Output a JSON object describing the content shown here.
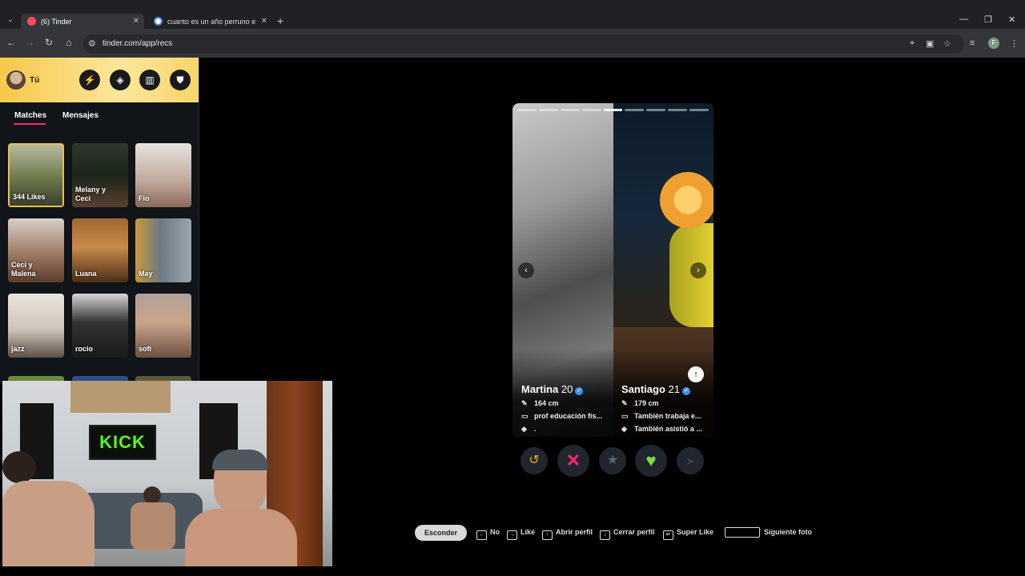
{
  "browser": {
    "tabs": [
      {
        "title": "(6) Tinder",
        "favicon": "tinder-flame-icon",
        "active": true
      },
      {
        "title": "cuanto es un año perruno en h",
        "favicon": "google-icon",
        "active": false
      }
    ],
    "new_tab_glyph": "+",
    "url": "tinder.com/app/recs",
    "profile_initial": "F"
  },
  "sidebar": {
    "user_label": "Tú",
    "header_buttons": [
      "boost-icon",
      "explore-icon",
      "briefcase-icon",
      "shield-icon"
    ],
    "tabs": [
      {
        "label": "Matches",
        "active": true
      },
      {
        "label": "Mensajes",
        "active": false
      }
    ],
    "likes_tile": {
      "count_text": "344 Likes"
    },
    "matches": [
      {
        "name": "Melany y\nCeci"
      },
      {
        "name": "Fio"
      },
      {
        "name": "Ceci y\nMalena"
      },
      {
        "name": "Luana"
      },
      {
        "name": "May"
      },
      {
        "name": "jazz"
      },
      {
        "name": "rocio"
      },
      {
        "name": "sofi"
      }
    ]
  },
  "webcam": {
    "sign_text": "KICK"
  },
  "card": {
    "photo_count": 9,
    "active_photo": 4,
    "profiles": [
      {
        "name": "Martina",
        "age": "20",
        "verified": true,
        "lines": [
          {
            "icon": "ruler-icon",
            "text": "164 cm"
          },
          {
            "icon": "briefcase-icon",
            "text": "prof educación fís..."
          },
          {
            "icon": "graduation-cap-icon",
            "text": "."
          }
        ]
      },
      {
        "name": "Santiago",
        "age": "21",
        "verified": true,
        "lines": [
          {
            "icon": "ruler-icon",
            "text": "179 cm"
          },
          {
            "icon": "briefcase-icon",
            "text": "También trabaja e..."
          },
          {
            "icon": "graduation-cap-icon",
            "text": "También asistió a ..."
          }
        ]
      }
    ]
  },
  "actions": [
    {
      "name": "rewind",
      "icon": "rewind-icon",
      "color": "#f5a623"
    },
    {
      "name": "nope",
      "icon": "x-icon",
      "color": "#fd267a"
    },
    {
      "name": "super-like",
      "icon": "star-icon",
      "color": "#5a6472"
    },
    {
      "name": "like",
      "icon": "heart-icon",
      "color": "#7dde3a"
    },
    {
      "name": "boost",
      "icon": "send-icon",
      "color": "#3a4049"
    }
  ],
  "shortcuts": {
    "hide_label": "Esconder",
    "items": [
      {
        "key": "left-arrow-key",
        "label": "No"
      },
      {
        "key": "right-arrow-key",
        "label": "Like"
      },
      {
        "key": "up-arrow-key",
        "label": "Abrir perfil"
      },
      {
        "key": "down-arrow-key",
        "label": "Cerrar perfil"
      },
      {
        "key": "enter-key",
        "label": "Super Like"
      },
      {
        "key": "space-key",
        "label": "Siguiente foto"
      }
    ]
  },
  "colors": {
    "tinder_pink": "#fd267a",
    "header_gold": "#f6c84a",
    "kick_green": "#53fc18"
  }
}
